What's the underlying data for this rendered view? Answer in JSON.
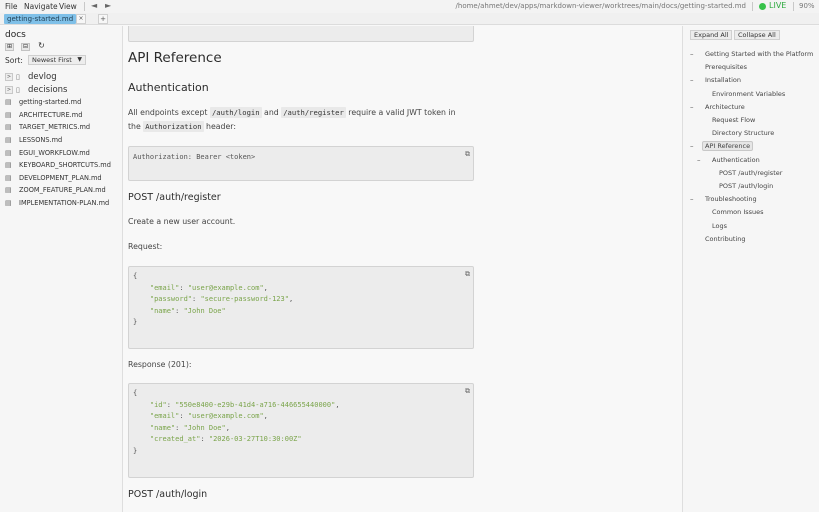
{
  "menubar": {
    "file": "File",
    "navigate": "Navigate",
    "view": "View",
    "back": "◄",
    "forward": "►",
    "path": "/home/ahmet/dev/apps/markdown-viewer/worktrees/main/docs/getting-started.md",
    "live": "LIVE",
    "zoom": "90%"
  },
  "tabs": {
    "active": "getting-started.md",
    "close": "×",
    "add": "+"
  },
  "sidebar": {
    "title": "docs",
    "buttons": [
      "⊞",
      "⊟",
      "↻"
    ],
    "sort_label": "Sort:",
    "sort_value": "Newest First",
    "folders": [
      "devlog",
      "decisions"
    ],
    "files": [
      "getting-started.md",
      "ARCHITECTURE.md",
      "TARGET_METRICS.md",
      "LESSONS.md",
      "EGUI_WORKFLOW.md",
      "KEYBOARD_SHORTCUTS.md",
      "DEVELOPMENT_PLAN.md",
      "ZOOM_FEATURE_PLAN.md",
      "IMPLEMENTATION-PLAN.md"
    ]
  },
  "content": {
    "h1": "API Reference",
    "h2_auth": "Authentication",
    "para1_a": "All endpoints except ",
    "code_login": "/auth/login",
    "para1_b": " and ",
    "code_register": "/auth/register",
    "para1_c": " require a valid JWT token in",
    "para1_d": "the ",
    "code_authorization": "Authorization",
    "para1_e": " header:",
    "auth_header_code": "Authorization: Bearer <token>",
    "h3_register": "POST /auth/register",
    "register_desc": "Create a new user account.",
    "request_label": "Request:",
    "request_code": {
      "open": "{",
      "email_key": "\"email\"",
      "email_val": "\"user@example.com\"",
      "password_key": "\"password\"",
      "password_val": "\"secure-password-123\"",
      "name_key": "\"name\"",
      "name_val": "\"John Doe\"",
      "close": "}"
    },
    "response_label": "Response (201):",
    "response_code": {
      "open": "{",
      "id_key": "\"id\"",
      "id_val": "\"550e8400-e29b-41d4-a716-446655440000\"",
      "email_key": "\"email\"",
      "email_val": "\"user@example.com\"",
      "name_key": "\"name\"",
      "name_val": "\"John Doe\"",
      "created_key": "\"created_at\"",
      "created_val": "\"2026-03-27T10:30:00Z\"",
      "close": "}"
    },
    "h3_login": "POST /auth/login",
    "copy_icon": "⧉"
  },
  "outline": {
    "expand_all": "Expand All",
    "collapse_all": "Collapse All",
    "dash": "–",
    "items": {
      "getting_started": "Getting Started with the Platform",
      "prerequisites": "Prerequisites",
      "installation": "Installation",
      "env_vars": "Environment Variables",
      "architecture": "Architecture",
      "request_flow": "Request Flow",
      "directory_structure": "Directory Structure",
      "api_reference": "API Reference",
      "authentication": "Authentication",
      "post_register": "POST /auth/register",
      "post_login": "POST /auth/login",
      "troubleshooting": "Troubleshooting",
      "common_issues": "Common Issues",
      "logs": "Logs",
      "contributing": "Contributing"
    }
  }
}
